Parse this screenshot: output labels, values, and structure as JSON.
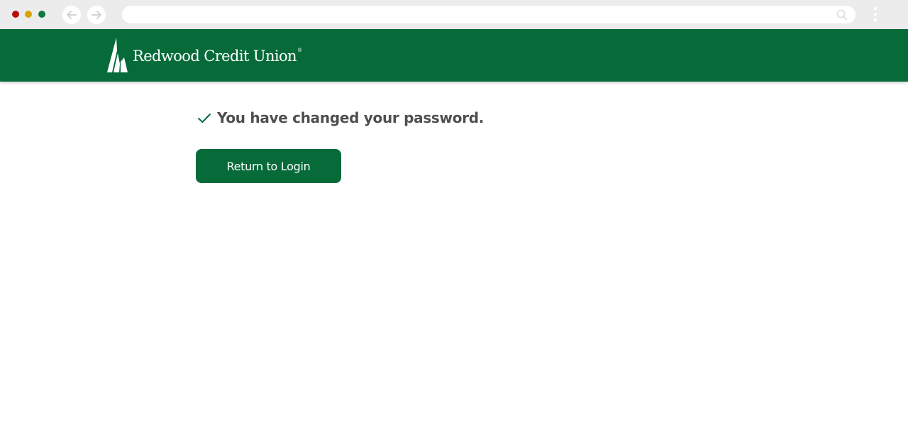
{
  "browser": {
    "traffic_lights": {
      "close_color": "#b80d0d",
      "minimize_color": "#d6a300",
      "maximize_color": "#117a3d"
    },
    "address_bar": {
      "value": ""
    },
    "icons": {
      "back": "arrow-left-icon",
      "forward": "arrow-right-icon",
      "search": "search-icon",
      "menu": "kebab-menu-icon"
    }
  },
  "header": {
    "brand_name": "Redwood Credit Union",
    "brand_mark": "®",
    "brand_color": "#066b39",
    "logo_icon": "redwood-tree-logo-icon"
  },
  "main": {
    "confirmation_message": "You have changed your password.",
    "confirmation_icon": "checkmark-icon",
    "return_button_label": "Return to Login"
  }
}
